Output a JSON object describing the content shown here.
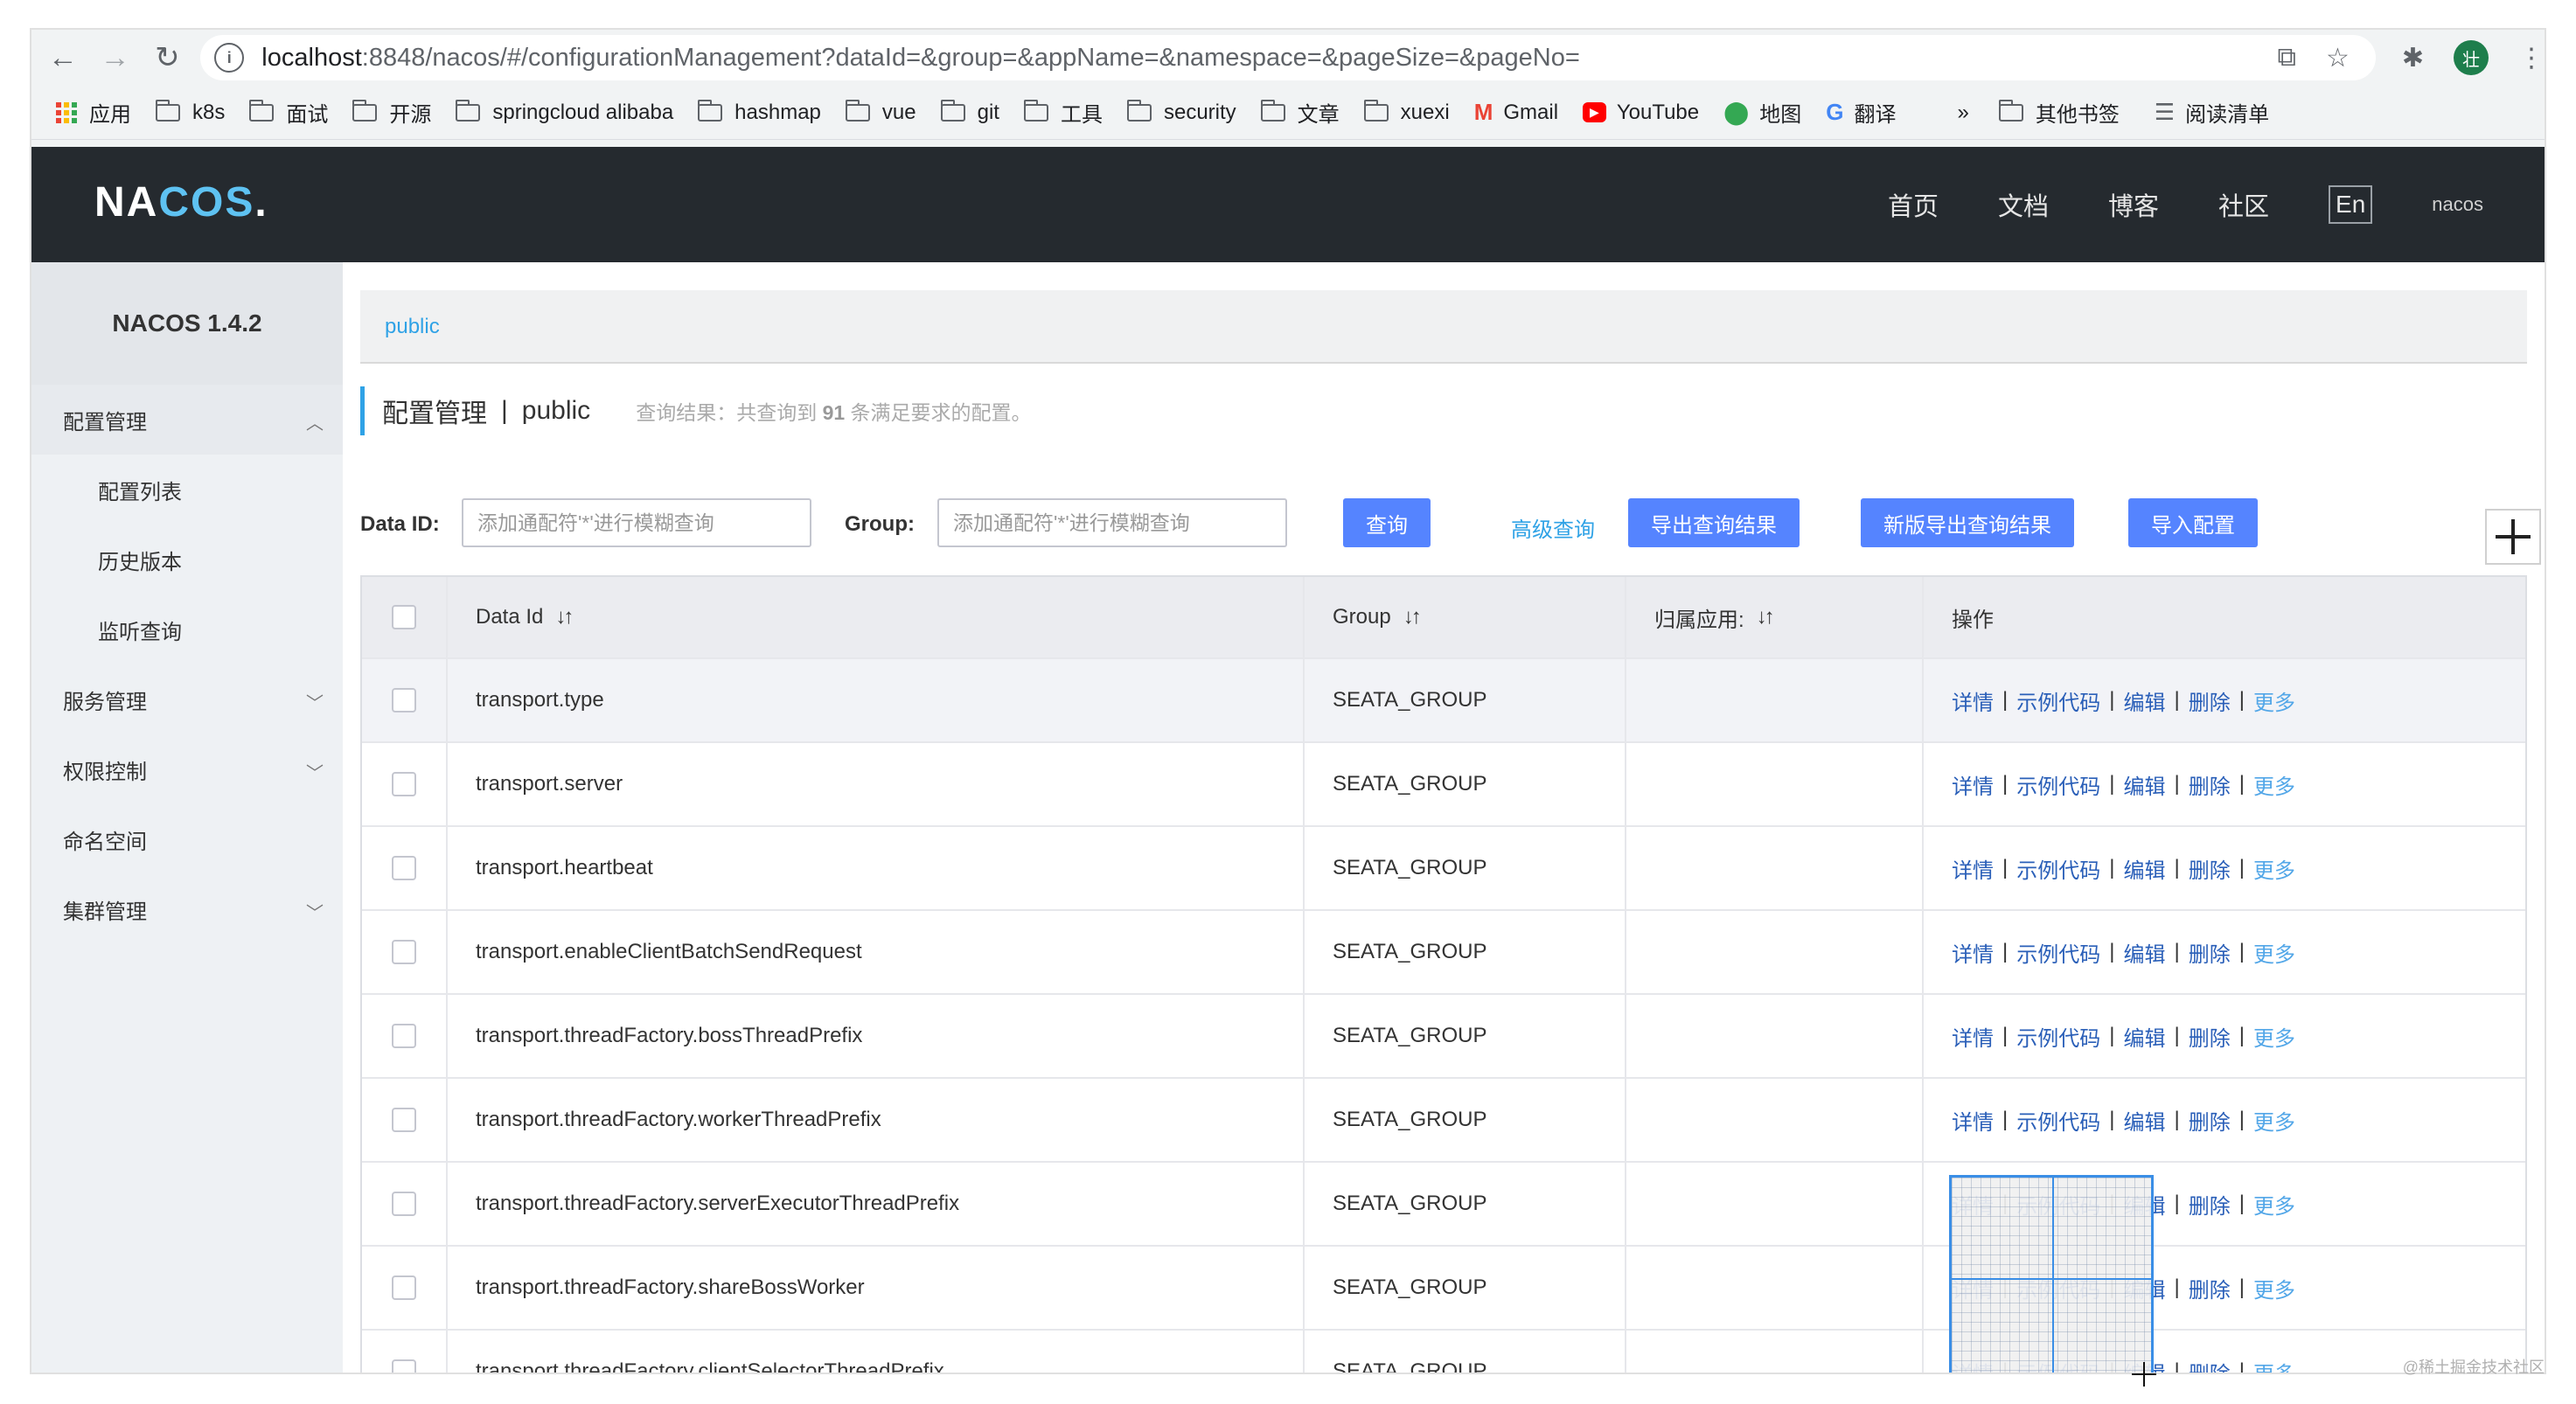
{
  "browser": {
    "url_host": "localhost",
    "url_rest": ":8848/nacos/#/configurationManagement?dataId=&group=&appName=&namespace=&pageSize=&pageNo=",
    "bookmarks": [
      {
        "label": "应用",
        "icon": "apps-grid-icon"
      },
      {
        "label": "k8s",
        "icon": "folder-icon"
      },
      {
        "label": "面试",
        "icon": "folder-icon"
      },
      {
        "label": "开源",
        "icon": "folder-icon"
      },
      {
        "label": "springcloud alibaba",
        "icon": "folder-icon"
      },
      {
        "label": "hashmap",
        "icon": "folder-icon"
      },
      {
        "label": "vue",
        "icon": "folder-icon"
      },
      {
        "label": "git",
        "icon": "folder-icon"
      },
      {
        "label": "工具",
        "icon": "folder-icon"
      },
      {
        "label": "security",
        "icon": "folder-icon"
      },
      {
        "label": "文章",
        "icon": "folder-icon"
      },
      {
        "label": "xuexi",
        "icon": "folder-icon"
      },
      {
        "label": "Gmail",
        "icon": "gmail-icon"
      },
      {
        "label": "YouTube",
        "icon": "youtube-icon"
      },
      {
        "label": "地图",
        "icon": "maps-pin-icon"
      },
      {
        "label": "翻译",
        "icon": "translate-icon"
      }
    ],
    "overflow": "»",
    "other_bookmarks": "其他书签",
    "reading_list": "阅读清单",
    "avatar_text": "壮"
  },
  "header": {
    "logo_left": "NA",
    "logo_mid": "COS",
    "logo_right": ".",
    "nav": [
      "首页",
      "文档",
      "博客",
      "社区"
    ],
    "lang": "En",
    "user": "nacos"
  },
  "sidebar": {
    "title": "NACOS 1.4.2",
    "config_mgmt": "配置管理",
    "config_list": "配置列表",
    "history": "历史版本",
    "listener": "监听查询",
    "service_mgmt": "服务管理",
    "auth": "权限控制",
    "namespace": "命名空间",
    "cluster": "集群管理"
  },
  "main": {
    "ns_link": "public",
    "page_title": "配置管理",
    "page_sep": "|",
    "page_ns": "public",
    "result_prefix": "查询结果：共查询到 ",
    "result_count": "91",
    "result_suffix": " 条满足要求的配置。",
    "dataid_label": "Data ID:",
    "dataid_placeholder": "添加通配符'*'进行模糊查询",
    "group_label": "Group:",
    "group_placeholder": "添加通配符'*'进行模糊查询",
    "query_btn": "查询",
    "advanced": "高级查询",
    "export_btn": "导出查询结果",
    "new_export_btn": "新版导出查询结果",
    "import_btn": "导入配置"
  },
  "table": {
    "headers": [
      "Data Id",
      "Group",
      "归属应用:",
      "操作"
    ],
    "sort_glyph": "↓↑",
    "op_labels": {
      "detail": "详情",
      "sample": "示例代码",
      "edit": "编辑",
      "delete": "删除",
      "more": "更多"
    },
    "pipe": "|",
    "rows": [
      {
        "data_id": "transport.type",
        "group": "SEATA_GROUP",
        "app": ""
      },
      {
        "data_id": "transport.server",
        "group": "SEATA_GROUP",
        "app": ""
      },
      {
        "data_id": "transport.heartbeat",
        "group": "SEATA_GROUP",
        "app": ""
      },
      {
        "data_id": "transport.enableClientBatchSendRequest",
        "group": "SEATA_GROUP",
        "app": ""
      },
      {
        "data_id": "transport.threadFactory.bossThreadPrefix",
        "group": "SEATA_GROUP",
        "app": ""
      },
      {
        "data_id": "transport.threadFactory.workerThreadPrefix",
        "group": "SEATA_GROUP",
        "app": ""
      },
      {
        "data_id": "transport.threadFactory.serverExecutorThreadPrefix",
        "group": "SEATA_GROUP",
        "app": ""
      },
      {
        "data_id": "transport.threadFactory.shareBossWorker",
        "group": "SEATA_GROUP",
        "app": ""
      },
      {
        "data_id": "transport.threadFactory.clientSelectorThreadPrefix",
        "group": "SEATA_GROUP",
        "app": ""
      }
    ]
  },
  "watermark": "@稀土掘金技术社区"
}
